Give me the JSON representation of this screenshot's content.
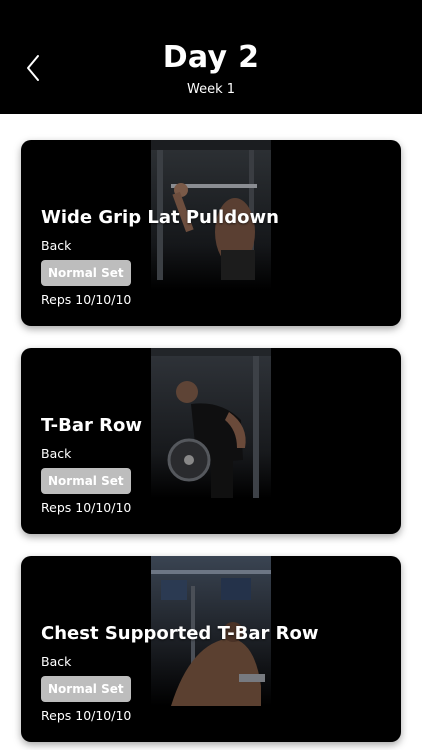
{
  "header": {
    "title": "Day 2",
    "subtitle": "Week 1",
    "back_icon": "chevron-left-icon"
  },
  "exercises": [
    {
      "name": "Wide Grip Lat Pulldown",
      "category": "Back",
      "set_type": "Normal Set",
      "reps": "Reps 10/10/10",
      "photo": "lat-pulldown-photo"
    },
    {
      "name": "T-Bar Row",
      "category": "Back",
      "set_type": "Normal Set",
      "reps": "Reps 10/10/10",
      "photo": "t-bar-row-photo"
    },
    {
      "name": "Chest Supported T-Bar Row",
      "category": "Back",
      "set_type": "Normal Set",
      "reps": "Reps 10/10/10",
      "photo": "chest-supported-row-photo"
    }
  ],
  "colors": {
    "header_bg": "#000000",
    "card_bg": "#000000",
    "badge_bg": "#bdbdbd",
    "text": "#ffffff"
  }
}
